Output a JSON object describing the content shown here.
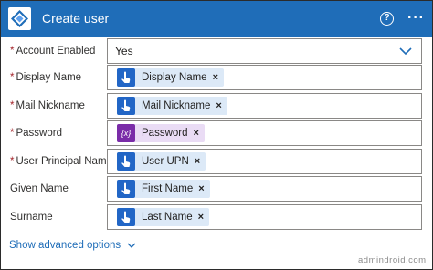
{
  "header": {
    "title": "Create user",
    "icon": "azure-ad-icon",
    "help_icon": "question-circle-icon",
    "help_glyph": "?",
    "more_icon": "ellipsis-icon",
    "more_glyph": "···",
    "background": "#1f6db8"
  },
  "required_marker": "*",
  "fields": {
    "account_enabled": {
      "label": "Account Enabled",
      "required": true,
      "value": "Yes"
    },
    "display_name": {
      "label": "Display Name",
      "required": true,
      "token": "Display Name",
      "token_type": "dynamic-content"
    },
    "mail_nickname": {
      "label": "Mail Nickname",
      "required": true,
      "token": "Mail Nickname",
      "token_type": "dynamic-content"
    },
    "password": {
      "label": "Password",
      "required": true,
      "token": "Password",
      "token_type": "expression",
      "token_glyph": "{x}"
    },
    "user_principal_name": {
      "label": "User Principal Name",
      "required": true,
      "token": "User UPN",
      "token_type": "dynamic-content"
    },
    "given_name": {
      "label": "Given Name",
      "required": false,
      "token": "First Name",
      "token_type": "dynamic-content"
    },
    "surname": {
      "label": "Surname",
      "required": false,
      "token": "Last Name",
      "token_type": "dynamic-content"
    }
  },
  "token_remove_glyph": "×",
  "advanced_options": "Show advanced options",
  "watermark": "admindroid.com",
  "colors": {
    "accent": "#1f6db8",
    "required": "#a4262c",
    "token_bg": "#dce9f7",
    "expression_bg": "#eadcf5",
    "expression_icon": "#7a2ca8"
  }
}
